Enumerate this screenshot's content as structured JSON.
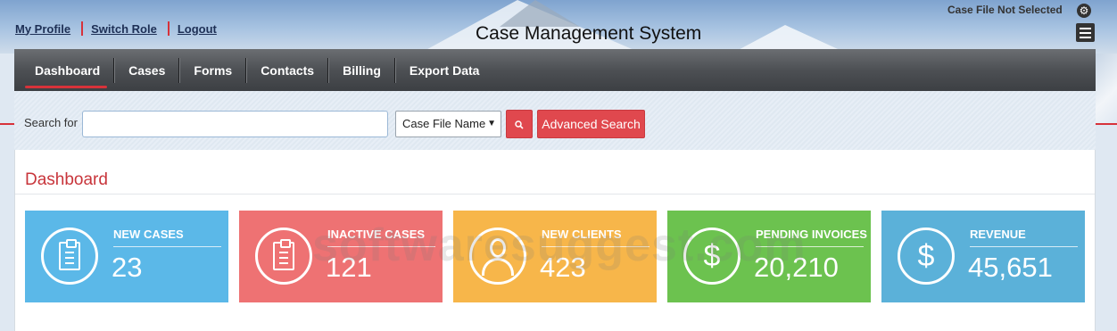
{
  "header": {
    "links": [
      "My Profile",
      "Switch Role",
      "Logout"
    ],
    "app_title": "Case Management System",
    "case_status": "Case File Not Selected"
  },
  "nav": {
    "items": [
      "Dashboard",
      "Cases",
      "Forms",
      "Contacts",
      "Billing",
      "Export Data"
    ],
    "active": "Dashboard"
  },
  "search": {
    "label": "Search for",
    "value": "",
    "field_selected": "Case File Name",
    "advanced_label": "Advanced Search"
  },
  "dashboard": {
    "title": "Dashboard",
    "cards": [
      {
        "label": "NEW CASES",
        "value": "23",
        "icon": "clipboard-icon",
        "color": "#5bb8e8"
      },
      {
        "label": "INACTIVE CASES",
        "value": "121",
        "icon": "clipboard-icon",
        "color": "#ee7273"
      },
      {
        "label": "NEW CLIENTS",
        "value": "423",
        "icon": "person-icon",
        "color": "#f7b64a"
      },
      {
        "label": "PENDING INVOICES",
        "value": "20,210",
        "icon": "dollar-icon",
        "color": "#6cc24f"
      },
      {
        "label": "REVENUE",
        "value": "45,651",
        "icon": "dollar-icon",
        "color": "#5bb1d9"
      }
    ]
  },
  "watermark": "softwaresuggest.com"
}
